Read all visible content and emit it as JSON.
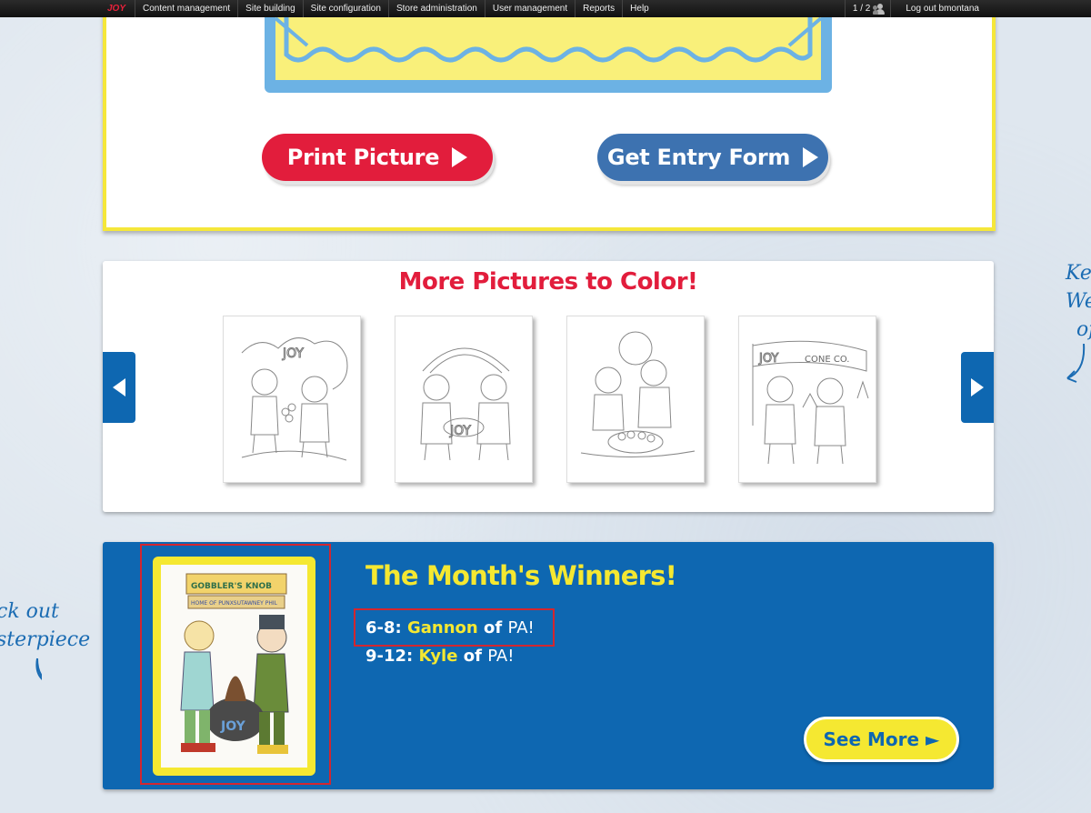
{
  "toolbar": {
    "logo": "JOY",
    "menu": [
      "Content management",
      "Site building",
      "Site configuration",
      "Store administration",
      "User management",
      "Reports",
      "Help"
    ],
    "user_count": "1 / 2",
    "logout": "Log out bmontana"
  },
  "actions": {
    "print_label": "Print Picture",
    "entry_label": "Get Entry Form"
  },
  "more": {
    "title": "More Pictures to Color!",
    "thumbnails": [
      {
        "banner": "JOY",
        "caption": ""
      },
      {
        "banner": "",
        "caption": "JOY"
      },
      {
        "banner": "",
        "caption": ""
      },
      {
        "banner": "JOY",
        "caption": "CONE CO."
      }
    ]
  },
  "winners": {
    "title": "The Month's Winners!",
    "entries": [
      {
        "age": "6-8",
        "name": "Gannon",
        "of": "of",
        "state": "PA!"
      },
      {
        "age": "9-12",
        "name": "Kyle",
        "of": "of",
        "state": "PA!"
      }
    ],
    "see_more": "See More ►",
    "image_sign": "GOBBLER'S KNOB",
    "image_subsign": "HOME OF PUNXSUTAWNEY PHIL",
    "image_tag": "JOY"
  },
  "side_notes": {
    "left": [
      "ck out",
      "sterpiece"
    ],
    "right": [
      "Ke",
      "We",
      "of"
    ]
  },
  "colors": {
    "red": "#e21d3c",
    "blue": "#0e67b1",
    "yellow": "#f5e831",
    "button_blue": "#3d72b0"
  }
}
